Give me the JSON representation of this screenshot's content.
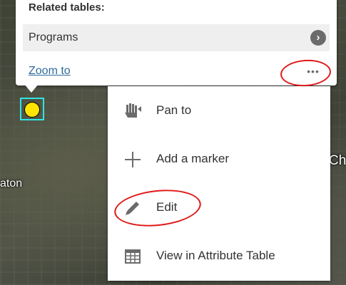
{
  "map": {
    "labels": {
      "left": "aton",
      "right": "Ch"
    }
  },
  "popup": {
    "related_heading": "Related tables:",
    "related_items": [
      {
        "label": "Programs",
        "icon": "chevron-right-icon"
      }
    ],
    "zoom_link": "Zoom to",
    "more_label": "•••"
  },
  "menu": {
    "items": [
      {
        "label": "Pan to",
        "icon": "hand-pan-icon"
      },
      {
        "label": "Add a marker",
        "icon": "plus-icon"
      },
      {
        "label": "Edit",
        "icon": "pencil-icon"
      },
      {
        "label": "View in Attribute Table",
        "icon": "table-icon"
      }
    ]
  },
  "colors": {
    "annotation": "#e01818",
    "marker_fill": "#ffe400",
    "marker_outline": "#2ee6e6",
    "link": "#2f6b9e"
  }
}
